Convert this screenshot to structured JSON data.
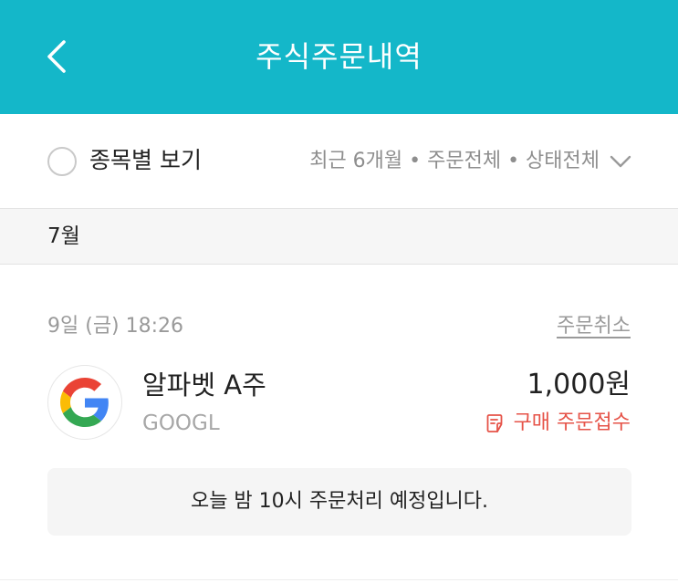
{
  "header": {
    "title": "주식주문내역",
    "back_icon": "chevron-left-icon",
    "background_color": "#14b7c9"
  },
  "filter": {
    "by_stock_label": "종목별 보기",
    "summary": "최근 6개월 • 주문전체 • 상태전체",
    "dropdown_icon": "chevron-down-icon"
  },
  "month": {
    "label": "7월"
  },
  "order": {
    "datetime": "9일 (금) 18:26",
    "cancel_label": "주문취소",
    "stock_name": "알파벳 A주",
    "ticker": "GOOGL",
    "amount": "1,000원",
    "status": "구매 주문접수",
    "status_color": "#e65348",
    "logo_icon": "google-logo",
    "notice": "오늘 밤 10시 주문처리 예정입니다."
  }
}
